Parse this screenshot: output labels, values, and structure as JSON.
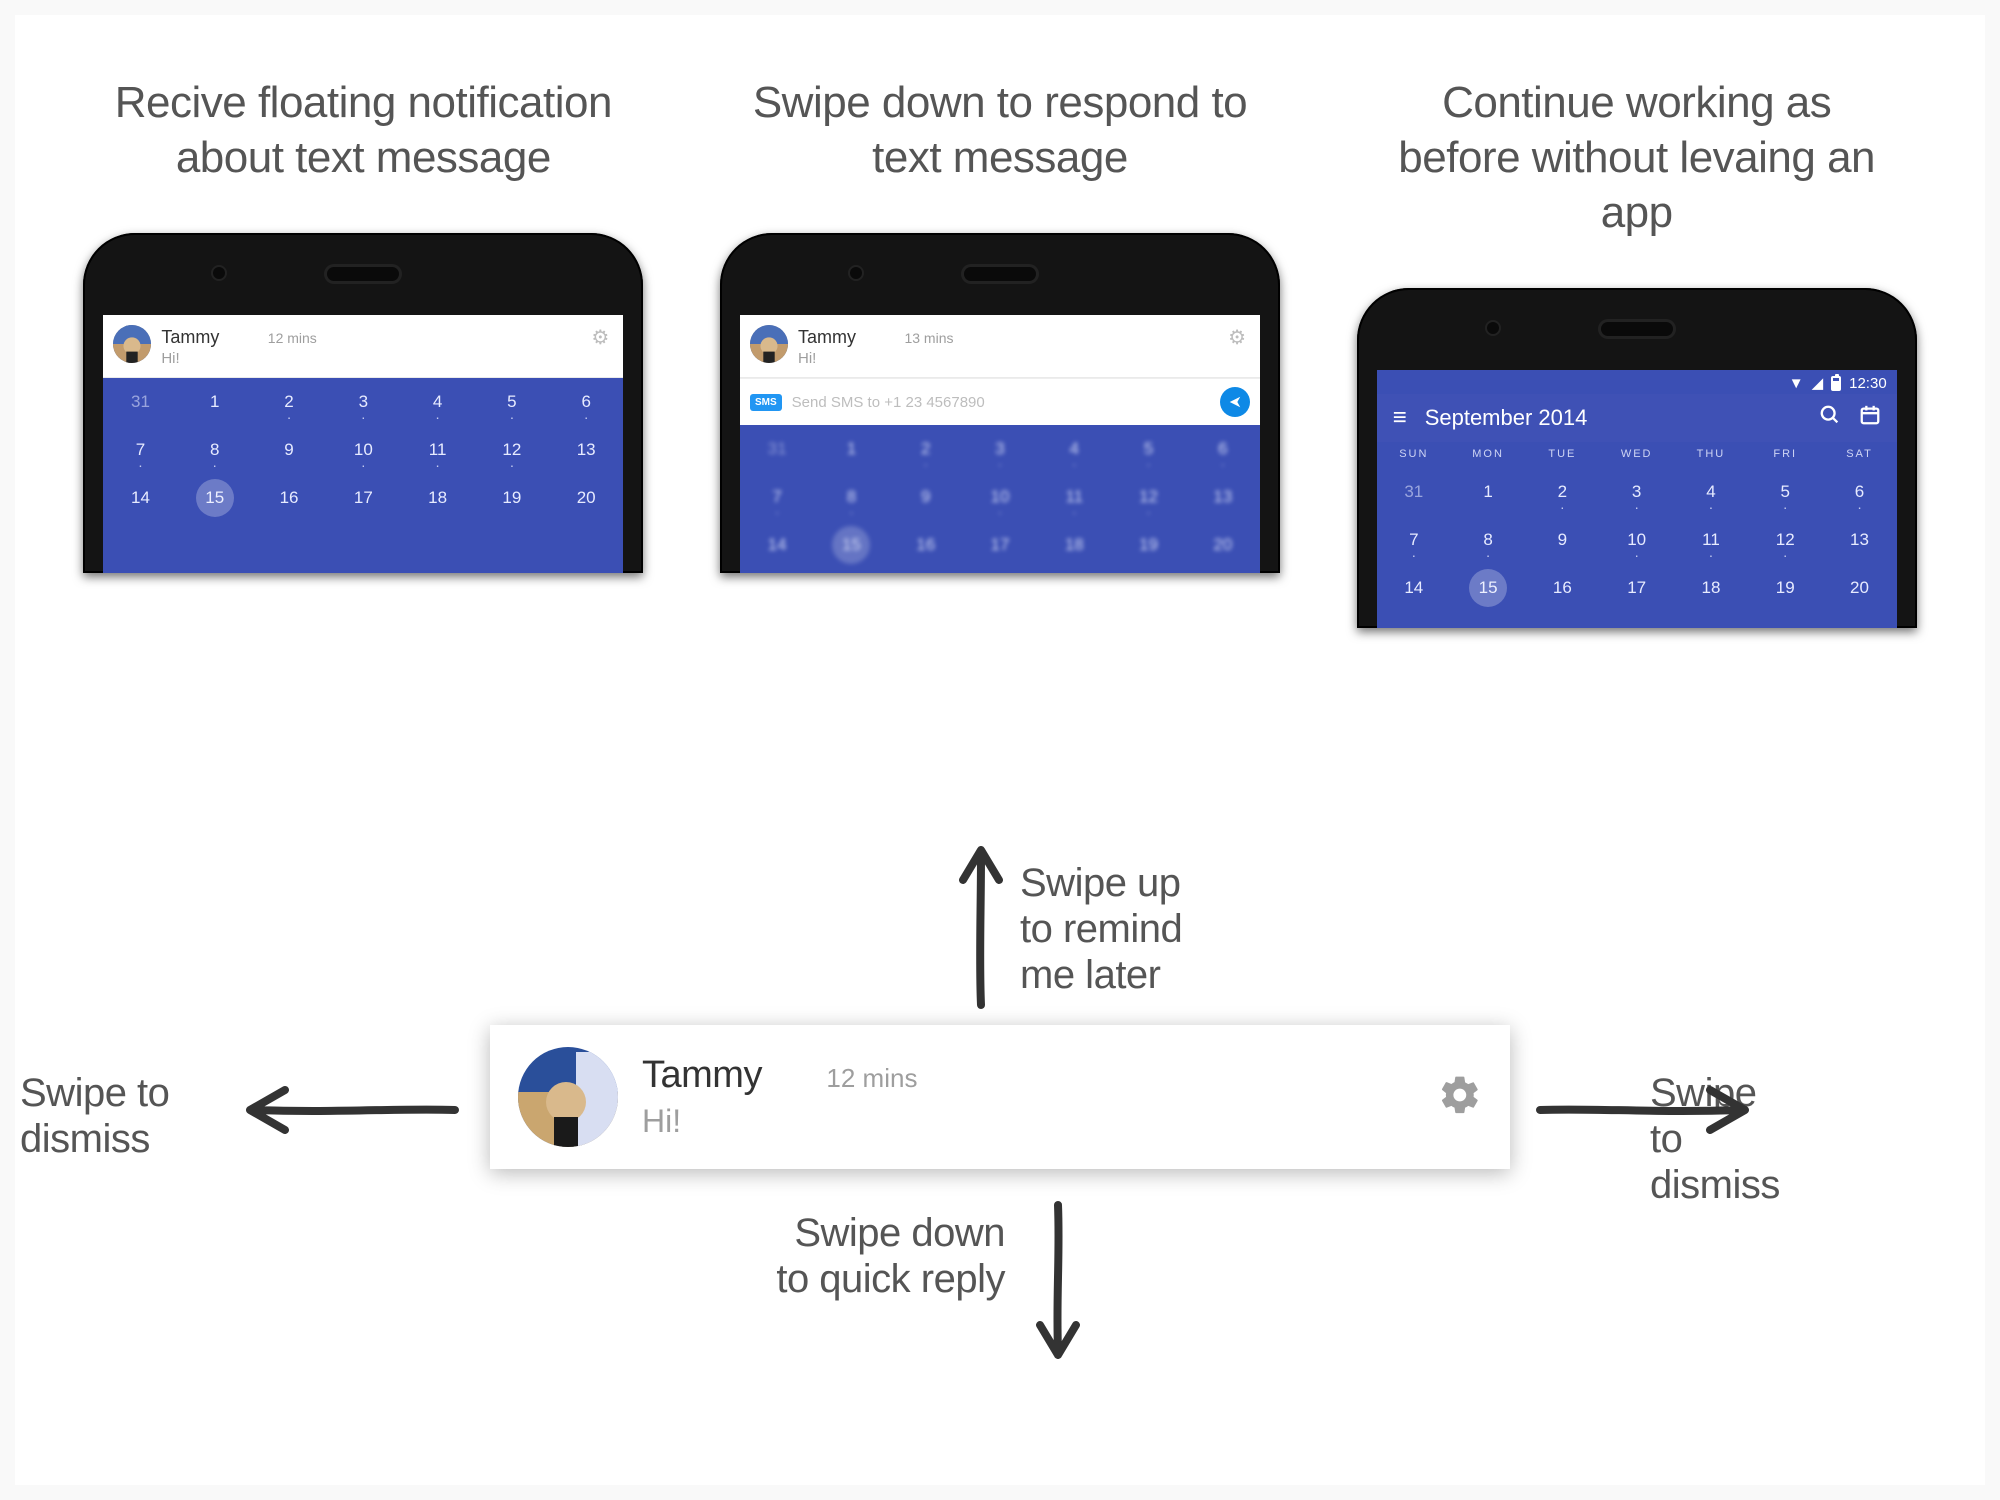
{
  "captions": {
    "c1": "Recive floating notification about text message",
    "c2": "Swipe down to respond to text message",
    "c3": "Continue working as before without levaing an app"
  },
  "notification": {
    "sender": "Tammy",
    "body": "Hi!",
    "time_small": "12 mins",
    "time_small2": "13 mins",
    "time_large": "12 mins"
  },
  "reply": {
    "sms_badge": "SMS",
    "placeholder": "Send SMS to +1 23 4567890"
  },
  "calendar": {
    "month_label": "September 2014",
    "clock": "12:30",
    "dow": [
      "SUN",
      "MON",
      "TUE",
      "WED",
      "THU",
      "FRI",
      "SAT"
    ],
    "rows": [
      [
        {
          "n": "31",
          "dim": true
        },
        {
          "n": "1"
        },
        {
          "n": "2",
          "dot": true
        },
        {
          "n": "3",
          "dot": true
        },
        {
          "n": "4",
          "dot": true
        },
        {
          "n": "5",
          "dot": true
        },
        {
          "n": "6",
          "dot": true
        }
      ],
      [
        {
          "n": "7",
          "dot": true
        },
        {
          "n": "8",
          "dot": true
        },
        {
          "n": "9"
        },
        {
          "n": "10",
          "dot": true
        },
        {
          "n": "11",
          "dot": true
        },
        {
          "n": "12",
          "dot": true
        },
        {
          "n": "13"
        }
      ],
      [
        {
          "n": "14"
        },
        {
          "n": "15",
          "sel": true
        },
        {
          "n": "16"
        },
        {
          "n": "17"
        },
        {
          "n": "18"
        },
        {
          "n": "19"
        },
        {
          "n": "20"
        }
      ]
    ]
  },
  "hints": {
    "up": "Swipe up to remind me later",
    "down": "Swipe down to quick reply",
    "left": "Swipe to dismiss",
    "right": "Swipe to dismiss"
  }
}
